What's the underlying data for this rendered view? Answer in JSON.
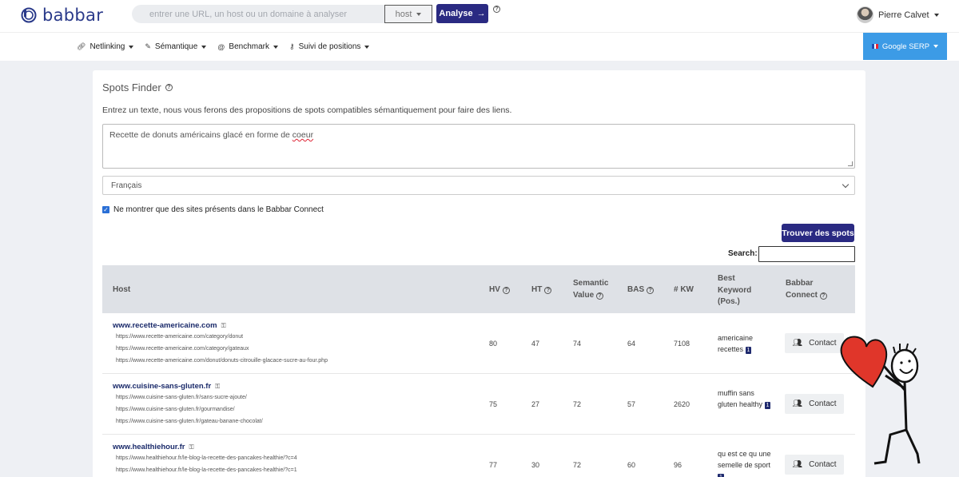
{
  "header": {
    "logo_text": "babbar",
    "search_placeholder": "entrer une URL, un host ou un domaine à analyser",
    "search_value": "",
    "host_select": "host",
    "analyse_label": "Analyse",
    "user_name": "Pierre Calvet"
  },
  "nav": {
    "items": [
      {
        "label": "Netlinking",
        "icon": "link-icon"
      },
      {
        "label": "Sémantique",
        "icon": "pen-icon"
      },
      {
        "label": "Benchmark",
        "icon": "spiral-icon"
      },
      {
        "label": "Suivi de positions",
        "icon": "key-icon"
      }
    ],
    "serp_label": "Google SERP"
  },
  "card": {
    "title": "Spots Finder",
    "intro": "Entrez un texte, nous vous ferons des propositions de spots compatibles sémantiquement pour faire des liens.",
    "textarea_text_a": "Recette de donuts américains glacé en forme de ",
    "textarea_text_b": "coeur",
    "language": "Français",
    "checkbox_label": "Ne montrer que des sites présents dans le Babbar Connect",
    "find_label": "Trouver des spots",
    "search_label": "Search:"
  },
  "table": {
    "headers": {
      "host": "Host",
      "hv": "HV",
      "ht": "HT",
      "semantic_1": "Semantic",
      "semantic_2": "Value",
      "bas": "BAS",
      "kw": "# KW",
      "best_1": "Best",
      "best_2": "Keyword",
      "best_3": "(Pos.)",
      "connect_1": "Babbar",
      "connect_2": "Connect"
    },
    "contact_label": "Contact",
    "rows": [
      {
        "host": "www.recette-americaine.com",
        "urls": [
          "https://www.recette-americaine.com/category/donut",
          "https://www.recette-americaine.com/category/gateaux",
          "https://www.recette-americaine.com/donut/donuts-citrouille-glacace-sucre-au-four.php"
        ],
        "hv": "80",
        "ht": "47",
        "sv": "74",
        "bas": "64",
        "kw": "7108",
        "best_kw": "americaine recettes",
        "pos": "1"
      },
      {
        "host": "www.cuisine-sans-gluten.fr",
        "urls": [
          "https://www.cuisine-sans-gluten.fr/sans-sucre-ajoute/",
          "https://www.cuisine-sans-gluten.fr/gourmandise/",
          "https://www.cuisine-sans-gluten.fr/gateau-banane-chocolat/"
        ],
        "hv": "75",
        "ht": "27",
        "sv": "72",
        "bas": "57",
        "kw": "2620",
        "best_kw": "muffin sans gluten healthy",
        "pos": "1"
      },
      {
        "host": "www.healthiehour.fr",
        "urls": [
          "https://www.healthiehour.fr/le-blog-la-recette-des-pancakes-healthie/?c=4",
          "https://www.healthiehour.fr/le-blog-la-recette-des-pancakes-healthie/?c=1"
        ],
        "hv": "77",
        "ht": "30",
        "sv": "72",
        "bas": "60",
        "kw": "96",
        "best_kw": "qu est ce qu une semelle de sport",
        "pos": "1"
      }
    ]
  }
}
